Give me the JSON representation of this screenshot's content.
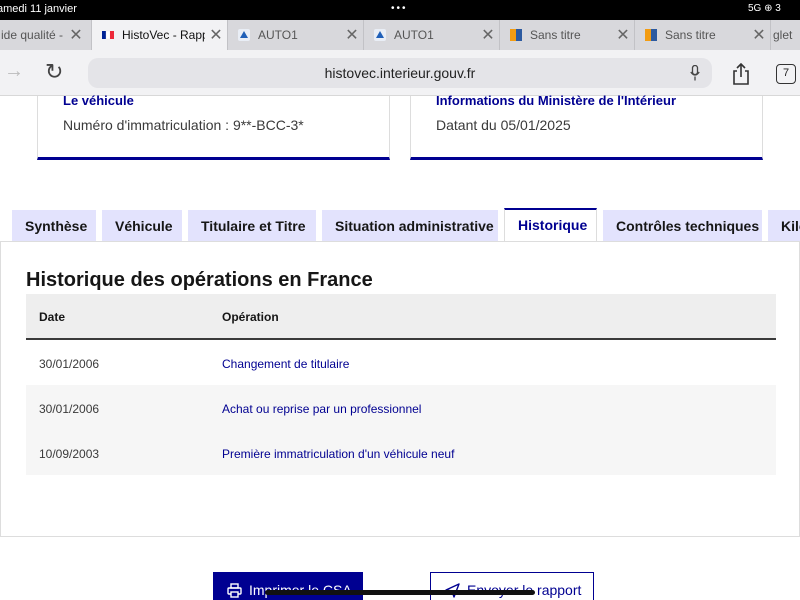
{
  "status_bar": {
    "time": "amedi 11 janvier",
    "dots": "•••",
    "right": "5G ⊕ 3"
  },
  "browser_tabs": [
    {
      "label": "ide qualité -",
      "favicon": "none"
    },
    {
      "label": "HistoVec - Rapp",
      "favicon": "french-flag-icon",
      "active": true
    },
    {
      "label": "AUTO1",
      "favicon": "auto1-icon"
    },
    {
      "label": "AUTO1",
      "favicon": "auto1-icon"
    },
    {
      "label": "Sans titre",
      "favicon": "orange-blue-icon"
    },
    {
      "label": "Sans titre",
      "favicon": "orange-blue-icon"
    },
    {
      "label": "glet",
      "favicon": "none"
    }
  ],
  "toolbar": {
    "url": "histovec.interieur.gouv.fr",
    "tab_count": "7"
  },
  "cards": {
    "vehicle": {
      "title": "Le véhicule",
      "text": "Numéro d'immatriculation : 9**-BCC-3*"
    },
    "ministry": {
      "title": "Informations du Ministère de l'Intérieur",
      "text": "Datant du 05/01/2025"
    }
  },
  "page_tabs": [
    {
      "label": "Synthèse"
    },
    {
      "label": "Véhicule"
    },
    {
      "label": "Titulaire et Titre"
    },
    {
      "label": "Situation administrative"
    },
    {
      "label": "Historique",
      "active": true
    },
    {
      "label": "Contrôles techniques"
    },
    {
      "label": "Kilo"
    }
  ],
  "history": {
    "title": "Historique des opérations en France",
    "columns": [
      "Date",
      "Opération"
    ],
    "rows": [
      {
        "date": "30/01/2006",
        "operation": "Changement de titulaire"
      },
      {
        "date": "30/01/2006",
        "operation": "Achat ou reprise par un professionnel"
      },
      {
        "date": "10/09/2003",
        "operation": "Première immatriculation d'un véhicule neuf"
      }
    ]
  },
  "buttons": {
    "print": "Imprimer le CSA",
    "send": "Envoyer le rapport"
  },
  "colors": {
    "accent": "#000091",
    "tab_bg": "#e3e3fd"
  }
}
